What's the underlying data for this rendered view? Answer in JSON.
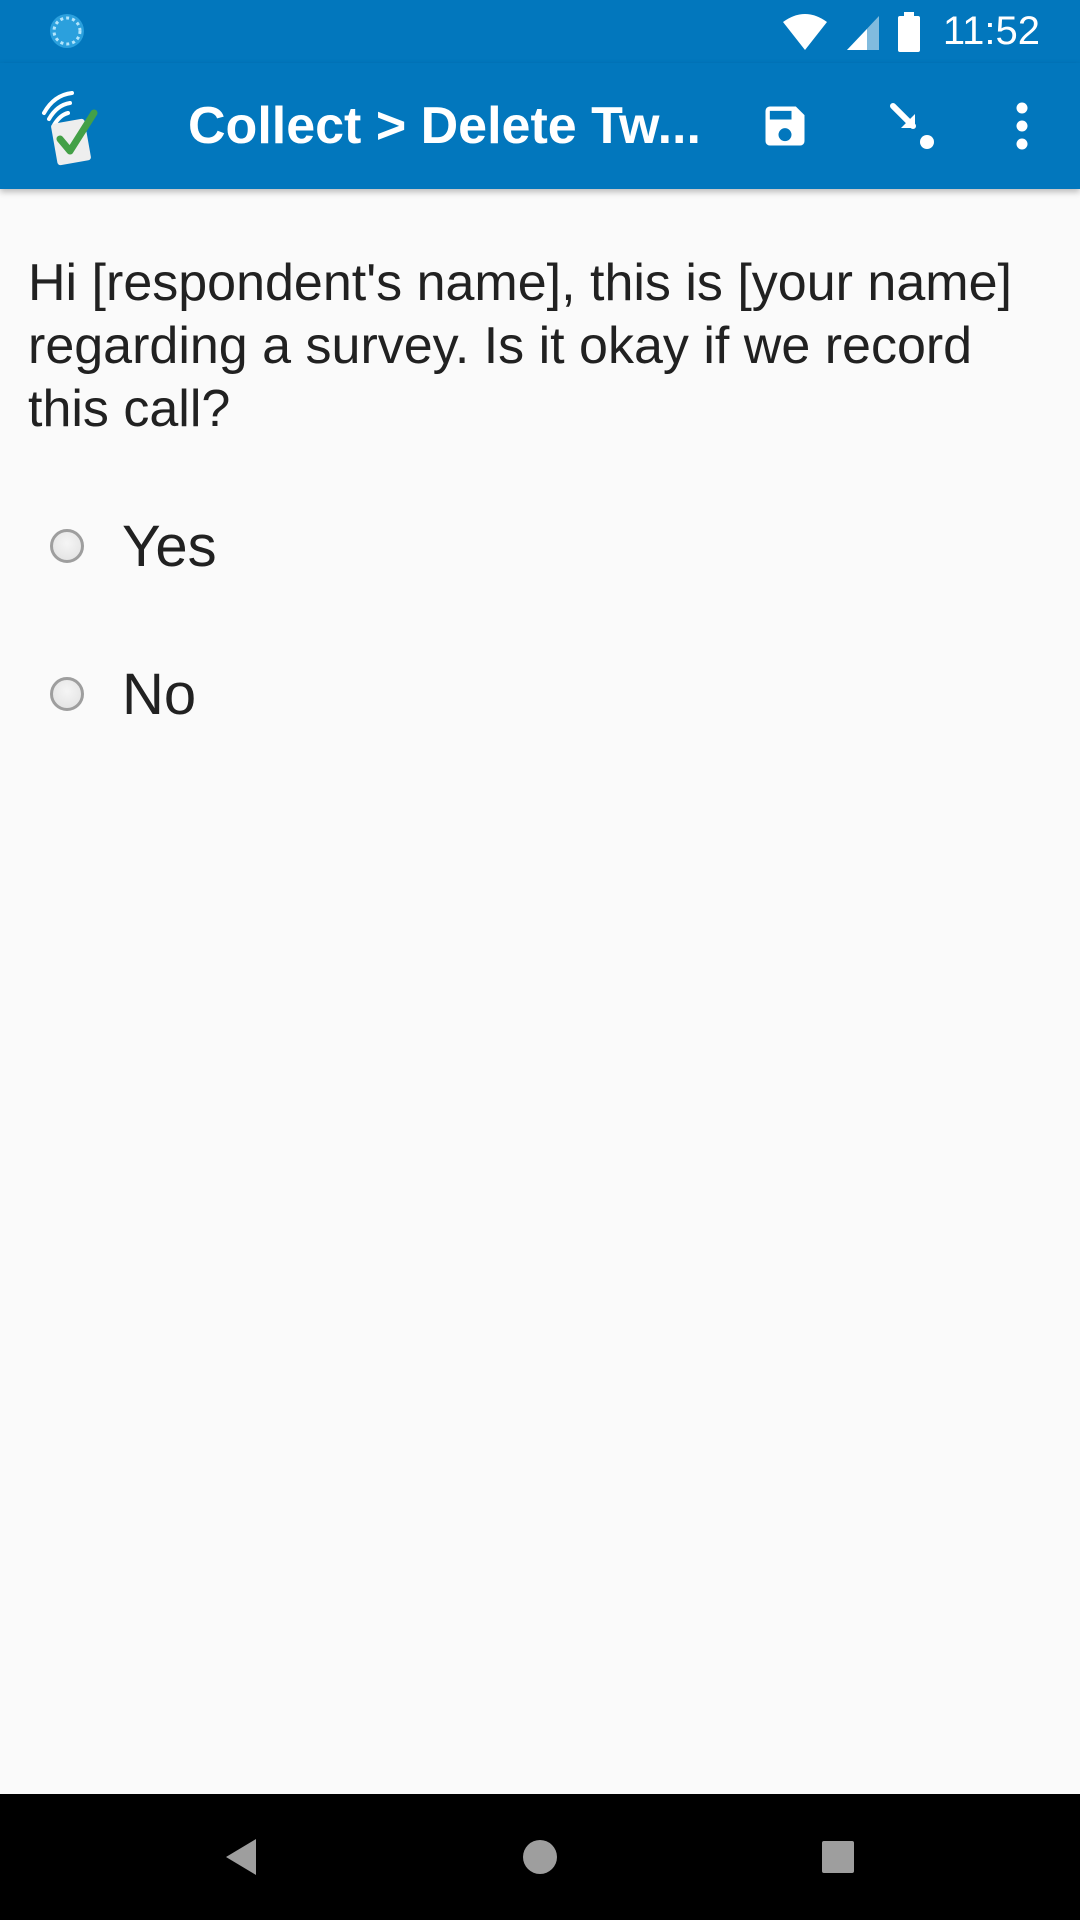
{
  "status_bar": {
    "time": "11:52",
    "icons": [
      "sync-icon",
      "wifi-icon",
      "cell-signal-icon",
      "battery-icon"
    ]
  },
  "toolbar": {
    "title": "Collect > Delete Tw...",
    "icons": [
      "app-logo-icon",
      "save-icon",
      "jump-icon",
      "more-vert-icon"
    ]
  },
  "question": {
    "text": "Hi [respondent's name], this is [your name] regarding a survey. Is it okay if we record this call?"
  },
  "options": [
    {
      "label": "Yes",
      "selected": false
    },
    {
      "label": "No",
      "selected": false
    }
  ],
  "nav_bar": {
    "icons": [
      "back-icon",
      "home-icon",
      "recents-icon"
    ]
  },
  "colors": {
    "primary": "#0277bd",
    "background": "#fafafa",
    "text": "#212121",
    "nav": "#000000"
  }
}
